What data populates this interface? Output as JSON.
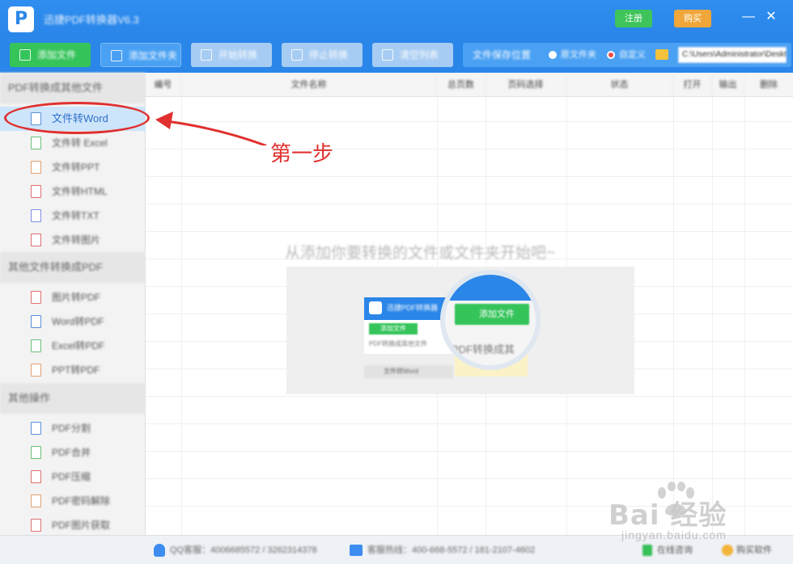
{
  "titlebar": {
    "logo_letter": "P",
    "app_title": "迅捷PDF转换器V6.3",
    "login_label": "注册",
    "buy_label": "购买",
    "minimize_glyph": "—",
    "close_glyph": "✕"
  },
  "toolbar": {
    "add_file_label": "添加文件",
    "add_folder_label": "添加文件夹",
    "start_label": "开始转换",
    "stop_label": "停止转换",
    "clear_label": "清空列表",
    "output_label": "文件保存位置",
    "option_original": "原文件夹",
    "option_custom": "自定义",
    "output_path": "C:\\Users\\Administrator\\Desktop\\"
  },
  "sidebar": {
    "sections": [
      {
        "title": "PDF转换成其他文件",
        "items": [
          "文件转Word",
          "文件转 Excel",
          "文件转PPT",
          "文件转HTML",
          "文件转TXT",
          "文件转图片"
        ]
      },
      {
        "title": "其他文件转换成PDF",
        "items": [
          "图片转PDF",
          "Word转PDF",
          "Excel转PDF",
          "PPT转PDF"
        ]
      },
      {
        "title": "其他操作",
        "items": [
          "PDF分割",
          "PDF合并",
          "PDF压缩",
          "PDF密码解除",
          "PDF图片获取"
        ]
      }
    ],
    "active_item": "文件转Word"
  },
  "table": {
    "columns": [
      "编号",
      "文件名称",
      "总页数",
      "页码选择",
      "状态",
      "打开",
      "输出",
      "删除"
    ]
  },
  "empty_state": {
    "message": "从添加你要转换的文件或文件夹开始吧~",
    "mini_title": "迅捷PDF转换器",
    "mini_button": "添加文件",
    "mini_label": "PDF转换成其他文件",
    "mini_row": "文件转Word",
    "mag_button": "添加文件",
    "mag_label": "PDF转换成其"
  },
  "annotation": {
    "text": "第一步",
    "color": "#e0302f"
  },
  "statusbar": {
    "qq_text": "QQ客服：4006685572 / 3262314378",
    "phone_text": "客服热线：400-668-5572 / 181-2107-4602",
    "online_label": "在线咨询",
    "feedback_label": "购买软件"
  },
  "watermark": {
    "brand": "Bai 经验",
    "site": "jingyan.baidu.com"
  },
  "colors": {
    "primary": "#2a86e8",
    "success": "#35c45a",
    "warning": "#f0a63a",
    "annotation": "#e0302f"
  }
}
